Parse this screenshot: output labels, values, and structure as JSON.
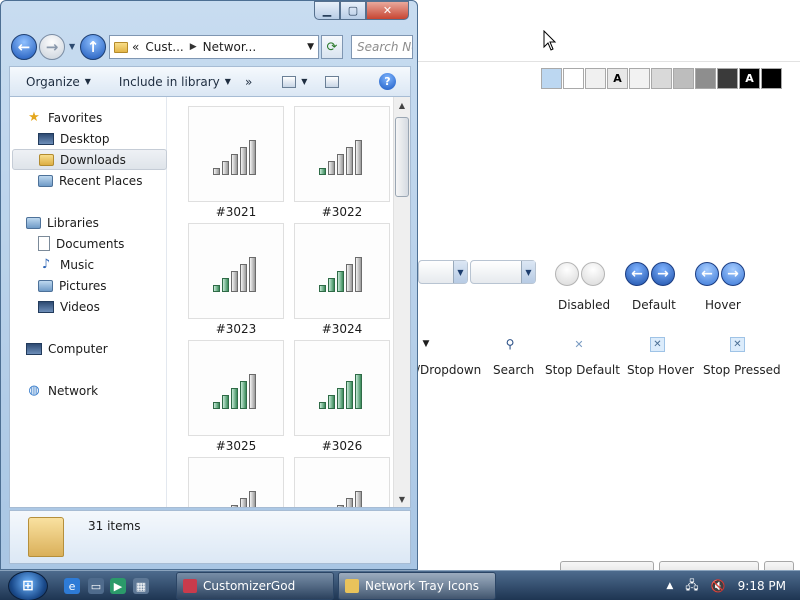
{
  "background_app": {
    "swatches": [
      {
        "text": "",
        "color": "#bcd7f1"
      },
      {
        "text": "",
        "color": "#ffffff"
      },
      {
        "text": "",
        "color": "#f0f0f0"
      },
      {
        "text": "A",
        "color": "#e8e8e8"
      },
      {
        "text": "",
        "color": "#f2f2f2"
      },
      {
        "text": "",
        "color": "#d9d9d9"
      },
      {
        "text": "",
        "color": "#bdbdbd"
      },
      {
        "text": "",
        "color": "#8e8e8e"
      },
      {
        "text": "",
        "color": "#3a3a3a"
      },
      {
        "text": "A",
        "color": "#000000"
      },
      {
        "text": "",
        "color": "#000000"
      }
    ],
    "nav_demo_labels": {
      "disabled": "Disabled",
      "default": "Default",
      "hover": "Hover"
    },
    "search_demo_labels": {
      "dropdown": "/Dropdown",
      "search": "Search",
      "stop_default": "Stop Default",
      "stop_hover": "Stop Hover",
      "stop_pressed": "Stop Pressed"
    }
  },
  "explorer": {
    "address": {
      "crumb_prefix": "«",
      "crumb1": "Cust...",
      "crumb2": "Networ..."
    },
    "search_placeholder": "Search Net",
    "toolbar": {
      "organize": "Organize",
      "include_in_library": "Include in library",
      "more": "»"
    },
    "nav_pane": {
      "favorites": "Favorites",
      "desktop": "Desktop",
      "downloads": "Downloads",
      "recent_places": "Recent Places",
      "libraries": "Libraries",
      "documents": "Documents",
      "music": "Music",
      "pictures": "Pictures",
      "videos": "Videos",
      "computer": "Computer",
      "network": "Network"
    },
    "files": [
      {
        "name": "#3021",
        "signal_bars_lit": 0
      },
      {
        "name": "#3022",
        "signal_bars_lit": 1
      },
      {
        "name": "#3023",
        "signal_bars_lit": 2
      },
      {
        "name": "#3024",
        "signal_bars_lit": 3
      },
      {
        "name": "#3025",
        "signal_bars_lit": 4
      },
      {
        "name": "#3026",
        "signal_bars_lit": 5
      },
      {
        "name": "",
        "signal_bars_lit": 0
      },
      {
        "name": "",
        "signal_bars_lit": 0
      }
    ],
    "details": {
      "items_count": "31 items"
    }
  },
  "taskbar": {
    "tasks": [
      {
        "label": "CustomizerGod",
        "color": "#c93b4c"
      },
      {
        "label": "Network Tray Icons",
        "color": "#e9c35b"
      }
    ],
    "clock": "9:18 PM"
  }
}
